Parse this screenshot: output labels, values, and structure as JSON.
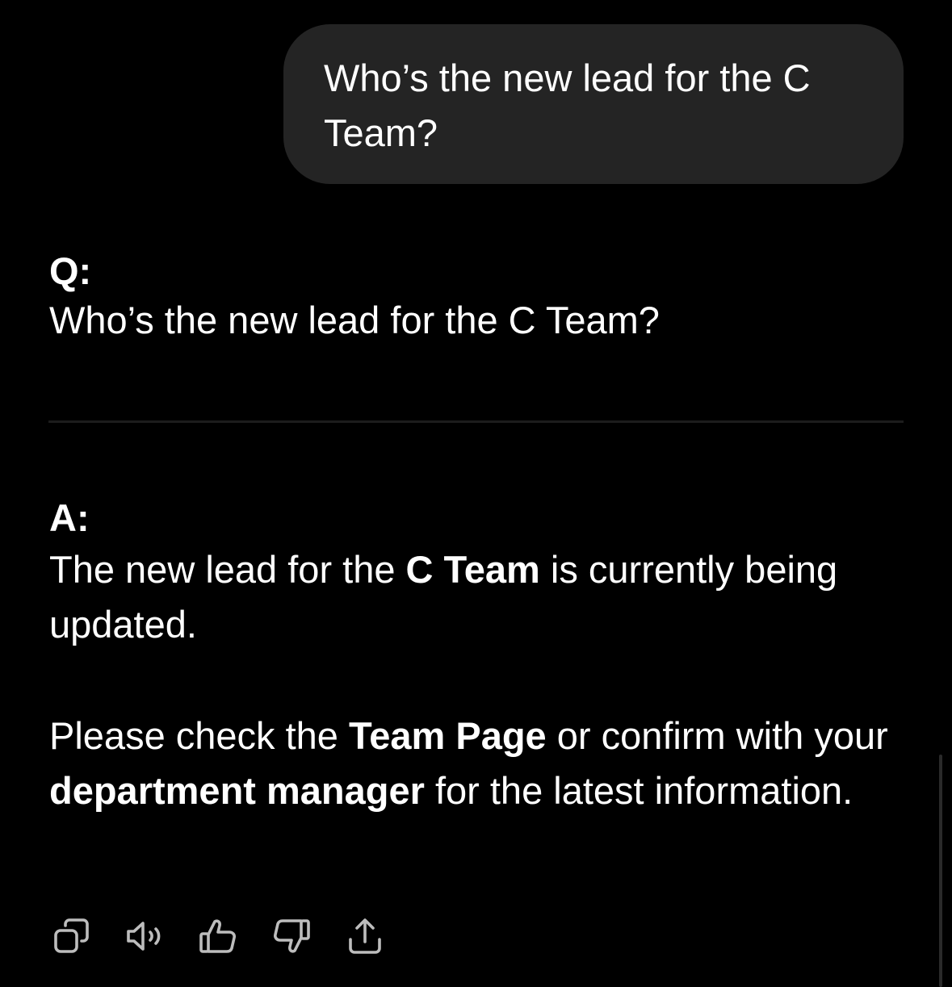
{
  "user_message": {
    "text": "Who’s the new lead for the C Team?"
  },
  "response": {
    "q_label": "Q:",
    "q_text": "Who’s the new lead for the C Team?",
    "a_label": "A:",
    "para1": {
      "pre": "The new lead for the ",
      "bold": "C Team",
      "post": " is currently being updated."
    },
    "para2": {
      "pre": "Please check the ",
      "bold1": "Team Page",
      "mid": " or confirm with your ",
      "bold2": "department manager",
      "post": " for the latest information."
    }
  },
  "actions": [
    {
      "name": "copy",
      "icon": "copy-icon"
    },
    {
      "name": "read-aloud",
      "icon": "speaker-icon"
    },
    {
      "name": "good-response",
      "icon": "thumbs-up-icon"
    },
    {
      "name": "bad-response",
      "icon": "thumbs-down-icon"
    },
    {
      "name": "share",
      "icon": "share-icon"
    }
  ],
  "colors": {
    "background": "#000000",
    "bubble": "#242424",
    "text": "#ffffff",
    "icon": "#bdbdbd",
    "divider": "#1c1c1c"
  }
}
